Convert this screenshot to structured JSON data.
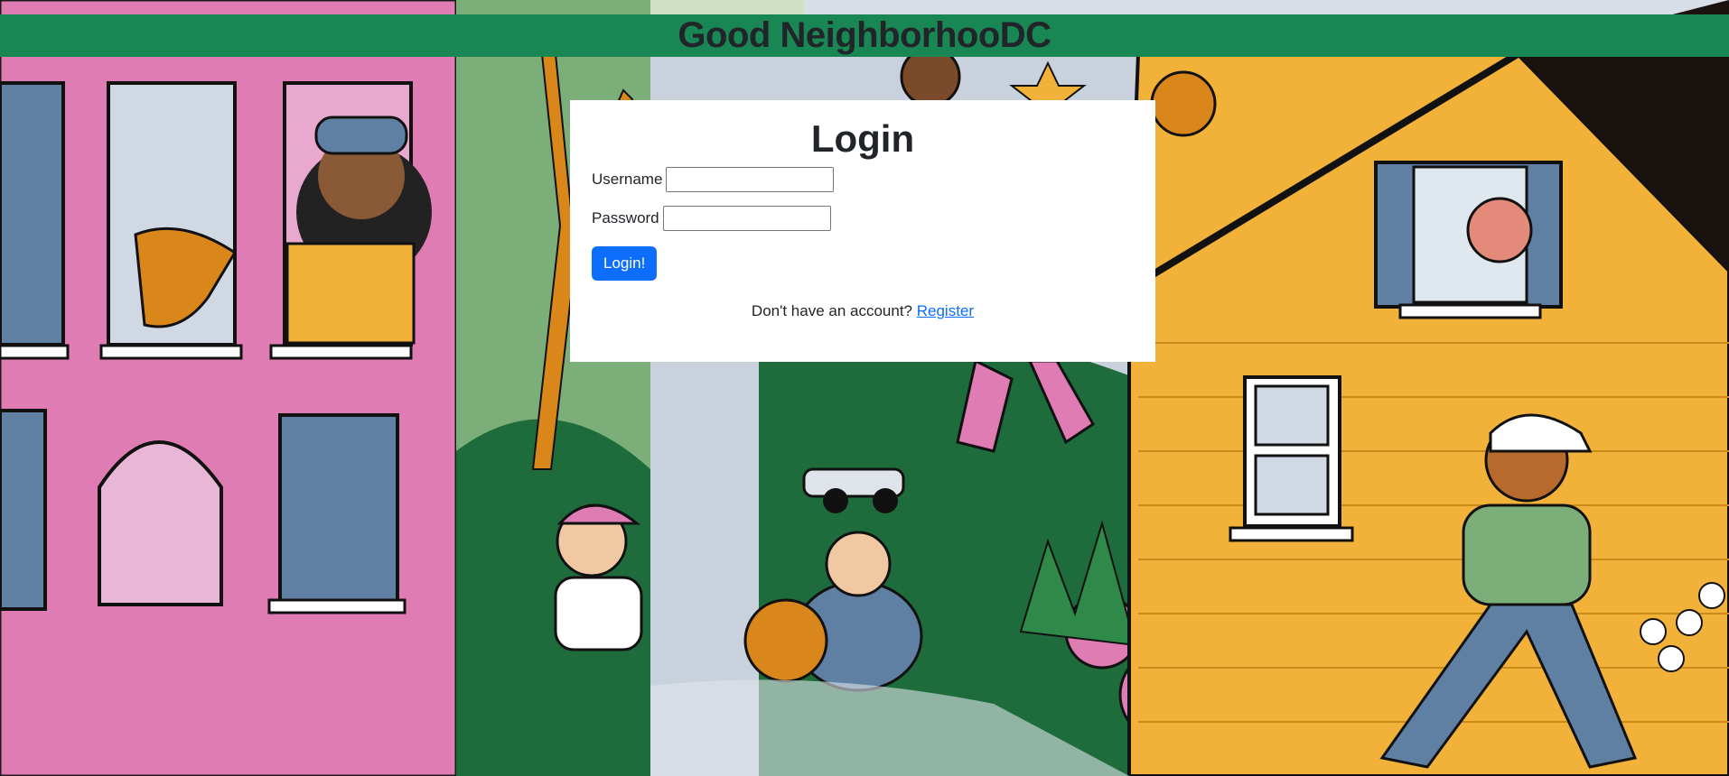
{
  "header": {
    "title": "Good NeighborhooDC"
  },
  "login": {
    "heading": "Login",
    "username_label": "Username",
    "username_value": "",
    "password_label": "Password",
    "password_value": "",
    "submit_label": "Login!",
    "register_prompt": "Don't have an account?",
    "register_link": "Register"
  },
  "background": {
    "description_icon": "illustrated-neighborhood-mural"
  },
  "colors": {
    "header_bg": "#198754",
    "button_bg": "#0d6efd",
    "link": "#0d6efd",
    "text": "#212529"
  }
}
